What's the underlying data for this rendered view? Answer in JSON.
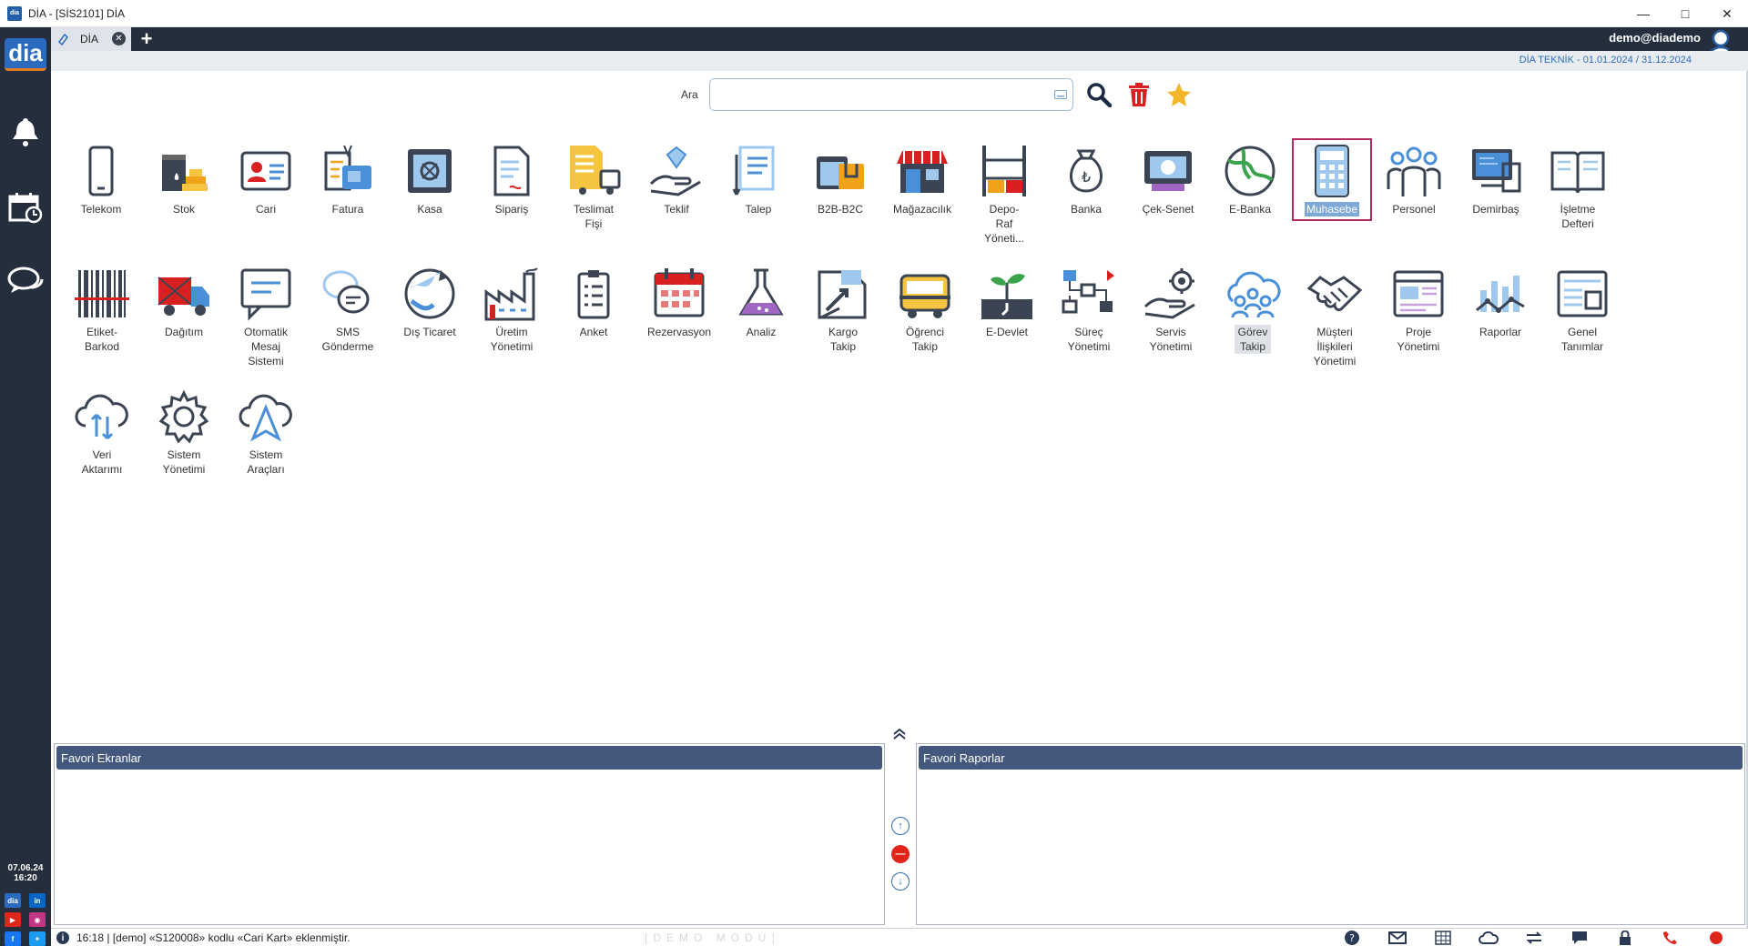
{
  "window": {
    "title": "DİA - [SİS2101] DİA",
    "app_icon": "dia"
  },
  "tabs": [
    {
      "label": "DİA"
    }
  ],
  "user": "demo@diademo",
  "period": "DİA TEKNİK -  01.01.2024 / 31.12.2024",
  "search": {
    "label": "Ara",
    "value": ""
  },
  "sidebar": {
    "logo": "dia",
    "date": "07.06.24",
    "time": "16:20",
    "social": [
      "dia",
      "in",
      "yt",
      "ig",
      "f",
      "tw"
    ]
  },
  "modules": [
    {
      "label": "Telekom",
      "icon": "phone-icon"
    },
    {
      "label": "Stok",
      "icon": "stock-icon"
    },
    {
      "label": "Cari",
      "icon": "id-card-icon"
    },
    {
      "label": "Fatura",
      "icon": "invoice-icon"
    },
    {
      "label": "Kasa",
      "icon": "safe-icon"
    },
    {
      "label": "Sipariş",
      "icon": "order-icon"
    },
    {
      "label": "Teslimat\nFişi",
      "icon": "delivery-icon"
    },
    {
      "label": "Teklif",
      "icon": "offer-icon"
    },
    {
      "label": "Talep",
      "icon": "request-icon"
    },
    {
      "label": "B2B-B2C",
      "icon": "b2b-icon"
    },
    {
      "label": "Mağazacılık",
      "icon": "store-icon"
    },
    {
      "label": "Depo-\nRaf\nYöneti...",
      "icon": "warehouse-icon"
    },
    {
      "label": "Banka",
      "icon": "bank-bag-icon"
    },
    {
      "label": "Çek-Senet",
      "icon": "cheque-icon"
    },
    {
      "label": "E-Banka",
      "icon": "globe-icon"
    },
    {
      "label": "Muhasebe",
      "icon": "calculator-icon"
    },
    {
      "label": "Personel",
      "icon": "people-icon"
    },
    {
      "label": "Demirbaş",
      "icon": "computer-icon"
    },
    {
      "label": "İşletme\nDefteri",
      "icon": "book-icon"
    },
    {
      "label": "Etiket-\nBarkod",
      "icon": "barcode-icon"
    },
    {
      "label": "Dağıtım",
      "icon": "truck-icon"
    },
    {
      "label": "Otomatik\nMesaj\nSistemi",
      "icon": "message-icon"
    },
    {
      "label": "SMS\nGönderme",
      "icon": "sms-icon"
    },
    {
      "label": "Dış Ticaret",
      "icon": "globe-trade-icon"
    },
    {
      "label": "Üretim\nYönetimi",
      "icon": "factory-icon"
    },
    {
      "label": "Anket",
      "icon": "survey-icon"
    },
    {
      "label": "Rezervasyon",
      "icon": "calendar-icon"
    },
    {
      "label": "Analiz",
      "icon": "flask-icon"
    },
    {
      "label": "Kargo\nTakip",
      "icon": "parcel-icon"
    },
    {
      "label": "Öğrenci\nTakip",
      "icon": "school-bus-icon"
    },
    {
      "label": "E-Devlet",
      "icon": "sprout-icon"
    },
    {
      "label": "Süreç\nYönetimi",
      "icon": "flowchart-icon"
    },
    {
      "label": "Servis\nYönetimi",
      "icon": "service-hand-icon"
    },
    {
      "label": "Görev\nTakip",
      "icon": "team-cloud-icon"
    },
    {
      "label": "Müşteri\nİlişkileri\nYönetimi",
      "icon": "handshake-icon"
    },
    {
      "label": "Proje\nYönetimi",
      "icon": "browser-icon"
    },
    {
      "label": "Raporlar",
      "icon": "chart-icon"
    },
    {
      "label": "Genel\nTanımlar",
      "icon": "settings-doc-icon"
    },
    {
      "label": "Veri\nAktarımı",
      "icon": "cloud-transfer-icon"
    },
    {
      "label": "Sistem\nYönetimi",
      "icon": "gear-icon"
    },
    {
      "label": "Sistem\nAraçları",
      "icon": "cloud-send-icon"
    }
  ],
  "favorites": {
    "screens_title": "Favori Ekranlar",
    "reports_title": "Favori Raporlar"
  },
  "status": {
    "message": "16:18 | [demo] «S120008» kodlu «Cari Kart» eklenmiştir.",
    "mode": "[DEMO MODU]"
  },
  "colors": {
    "sidebar": "#252e3d",
    "accent": "#2f6db5",
    "selection": "#b4285f",
    "fav_header": "#44587d"
  }
}
